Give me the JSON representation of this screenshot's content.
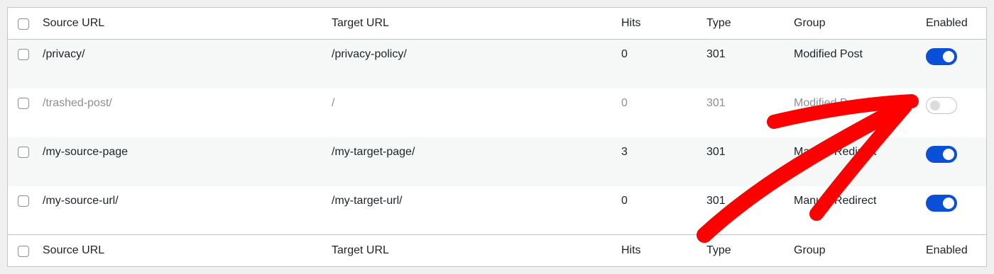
{
  "columns": {
    "source": "Source URL",
    "target": "Target URL",
    "hits": "Hits",
    "type": "Type",
    "group": "Group",
    "enabled": "Enabled"
  },
  "rows": [
    {
      "source": "/privacy/",
      "target": "/privacy-policy/",
      "hits": "0",
      "type": "301",
      "group": "Modified Post",
      "enabled": true
    },
    {
      "source": "/trashed-post/",
      "target": "/",
      "hits": "0",
      "type": "301",
      "group": "Modified Post",
      "enabled": false
    },
    {
      "source": "/my-source-page",
      "target": "/my-target-page/",
      "hits": "3",
      "type": "301",
      "group": "Manual Redirect",
      "enabled": true
    },
    {
      "source": "/my-source-url/",
      "target": "/my-target-url/",
      "hits": "0",
      "type": "301",
      "group": "Manual Redirect",
      "enabled": true
    }
  ],
  "colors": {
    "toggle_on": "#0a4fd8",
    "annotation_arrow": "#ff0000"
  },
  "annotation": {
    "icon": "red-arrow-icon",
    "points_to": "enabled-toggle-row-2"
  }
}
